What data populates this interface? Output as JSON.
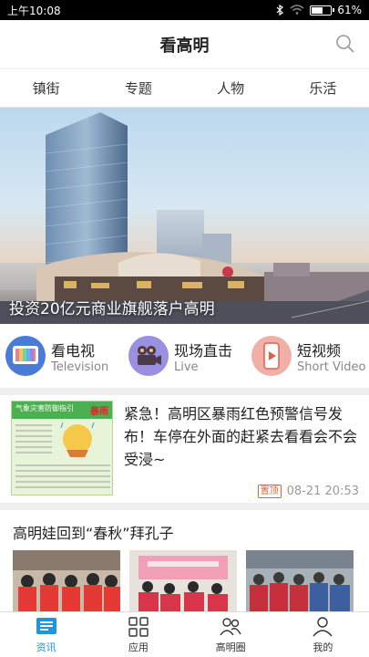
{
  "status_bar": {
    "time": "上午10:08",
    "battery_level": 0.61,
    "battery": "61%"
  },
  "header": {
    "title": "看高明"
  },
  "tabs": [
    {
      "label": "镇街"
    },
    {
      "label": "专题"
    },
    {
      "label": "人物"
    },
    {
      "label": "乐活"
    }
  ],
  "hero": {
    "caption": "投资20亿元商业旗舰落户高明"
  },
  "quick_links": [
    {
      "title": "看电视",
      "subtitle": "Television",
      "color": "#4a7bd6"
    },
    {
      "title": "现场直击",
      "subtitle": "Live",
      "color": "#9b8fe0"
    },
    {
      "title": "短视频",
      "subtitle": "Short Video",
      "color": "#f08a7a"
    }
  ],
  "news": {
    "title": "紧急！高明区暴雨红色预警信号发布！车停在外面的赶紧去看看会不会受浸~",
    "tag": "置顶",
    "time": "08-21 20:53",
    "thumb_heading": "气象灾害防御指引",
    "thumb_keyword": "暴雨"
  },
  "album": {
    "title": "高明娃回到“春秋”拜孔子"
  },
  "bottom_nav": [
    {
      "label": "资讯"
    },
    {
      "label": "应用"
    },
    {
      "label": "高明圈"
    },
    {
      "label": "我的"
    }
  ],
  "colors": {
    "accent": "#1e95e0",
    "tag": "#e0622e"
  }
}
